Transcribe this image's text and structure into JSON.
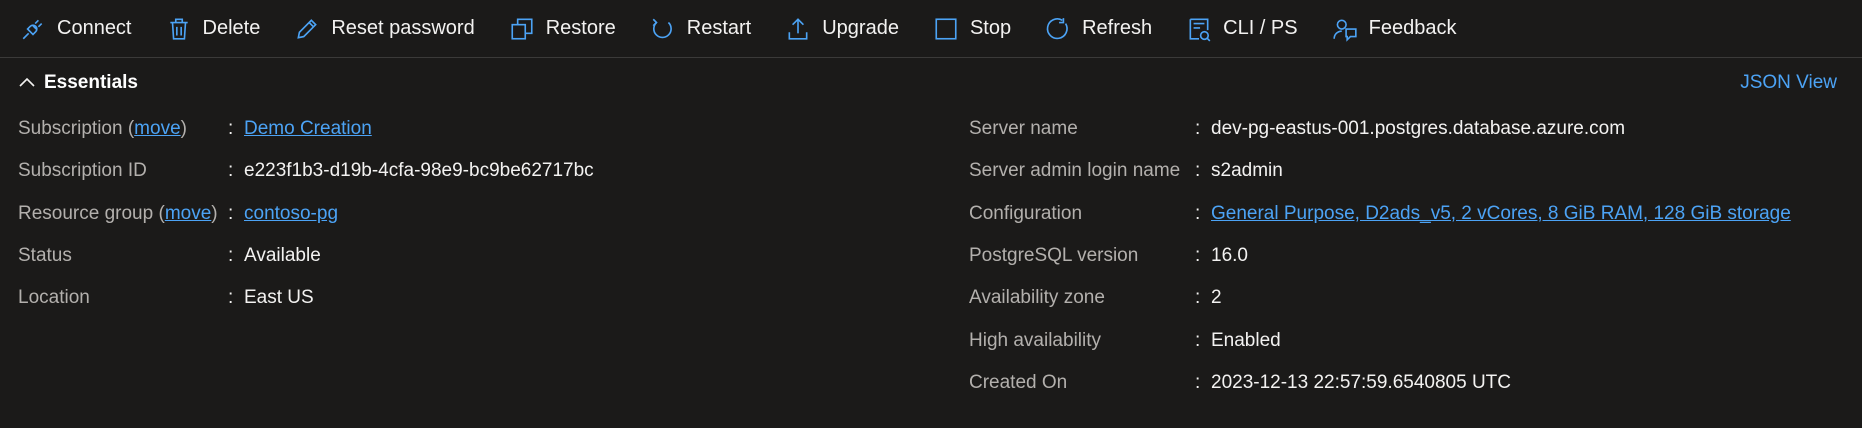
{
  "toolbar": {
    "items": [
      {
        "label": "Connect",
        "icon": "plug-icon"
      },
      {
        "label": "Delete",
        "icon": "trash-icon"
      },
      {
        "label": "Reset password",
        "icon": "pencil-icon"
      },
      {
        "label": "Restore",
        "icon": "restore-icon"
      },
      {
        "label": "Restart",
        "icon": "restart-icon"
      },
      {
        "label": "Upgrade",
        "icon": "upload-icon"
      },
      {
        "label": "Stop",
        "icon": "stop-icon"
      },
      {
        "label": "Refresh",
        "icon": "refresh-icon"
      },
      {
        "label": "CLI / PS",
        "icon": "cli-icon"
      },
      {
        "label": "Feedback",
        "icon": "feedback-icon"
      }
    ]
  },
  "essentials": {
    "title": "Essentials",
    "json_view": "JSON View",
    "left": [
      {
        "label": "Subscription",
        "move": "move",
        "value": "Demo Creation",
        "value_link": true
      },
      {
        "label": "Subscription ID",
        "value": "e223f1b3-d19b-4cfa-98e9-bc9be62717bc"
      },
      {
        "label": "Resource group",
        "move": "move",
        "value": "contoso-pg",
        "value_link": true
      },
      {
        "label": "Status",
        "value": "Available"
      },
      {
        "label": "Location",
        "value": "East US"
      }
    ],
    "right": [
      {
        "label": "Server name",
        "value": "dev-pg-eastus-001.postgres.database.azure.com"
      },
      {
        "label": "Server admin login name",
        "value": "s2admin"
      },
      {
        "label": "Configuration",
        "value": "General Purpose, D2ads_v5, 2 vCores, 8 GiB RAM, 128 GiB storage",
        "value_link": true
      },
      {
        "label": "PostgreSQL version",
        "value": "16.0"
      },
      {
        "label": "Availability zone",
        "value": "2"
      },
      {
        "label": "High availability",
        "value": "Enabled"
      },
      {
        "label": "Created On",
        "value": "2023-12-13 22:57:59.6540805 UTC"
      }
    ]
  },
  "colors": {
    "background": "#1b1a19",
    "accent": "#4ca3f5",
    "label": "#b3b0ad",
    "text": "#f3f2f1"
  }
}
